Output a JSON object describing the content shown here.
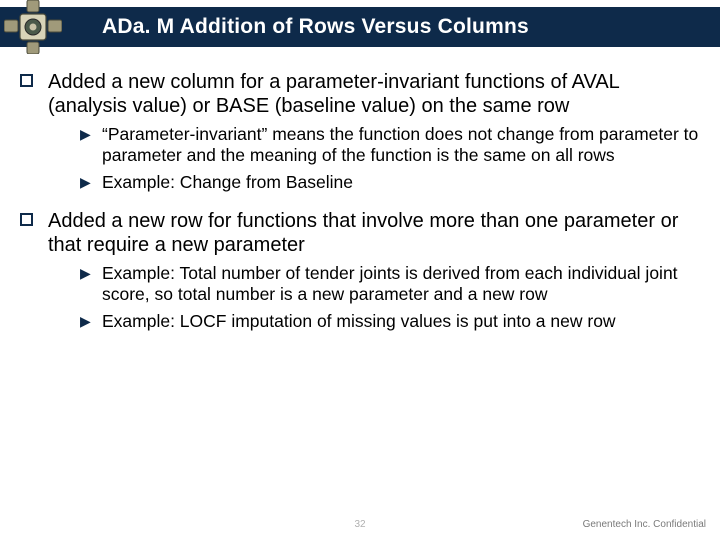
{
  "header": {
    "title": "ADa. M Addition of Rows Versus Columns"
  },
  "bullets": {
    "b1": {
      "text": "Added a new column for a parameter-invariant functions of AVAL (analysis value) or BASE (baseline value) on the same row",
      "sub1": "“Parameter-invariant” means the function does not change from parameter to parameter and the meaning of the function is the same on all rows",
      "sub2": "Example:  Change from Baseline"
    },
    "b2": {
      "text": "Added a new row for functions that involve more than one parameter or that require a new parameter",
      "sub1": "Example:  Total number of tender joints is derived from each individual joint score, so total number is a new parameter and a new row",
      "sub2": "Example:  LOCF imputation of missing values is put into a new row"
    }
  },
  "footer": {
    "page": "32",
    "confidential": "Genentech Inc. Confidential"
  }
}
